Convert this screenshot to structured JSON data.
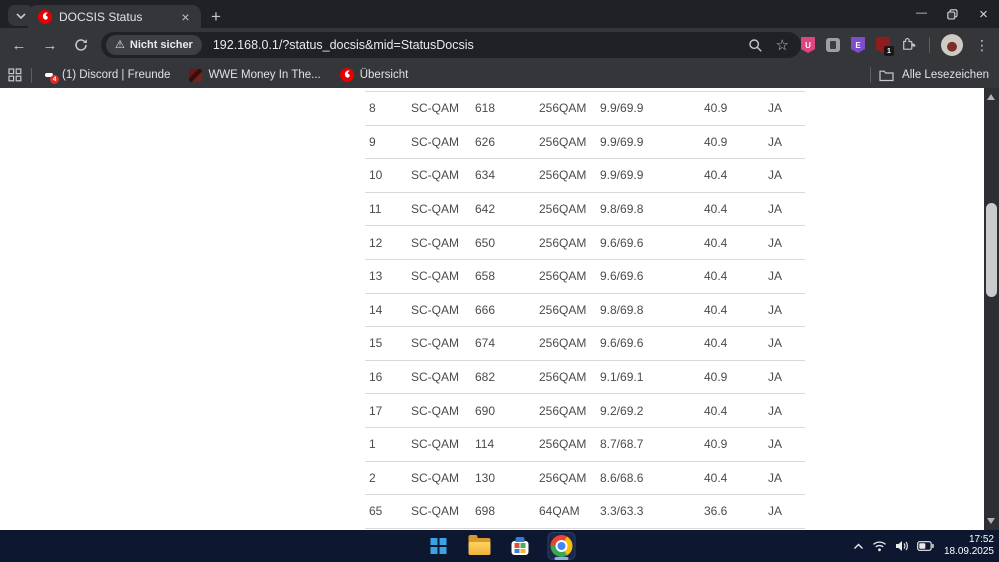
{
  "browser": {
    "tab": {
      "title": "DOCSIS Status",
      "close_glyph": "×"
    },
    "new_tab_glyph": "+",
    "window_controls": {
      "minimize_glyph": "—",
      "close_glyph": "×"
    },
    "nav": {
      "back_glyph": "←",
      "forward_glyph": "→"
    },
    "omnibox": {
      "warning_glyph": "⚠",
      "security_label": "Nicht sicher",
      "url": "192.168.0.1/?status_docsis&mid=StatusDocsis",
      "star_glyph": "☆"
    },
    "extensions": {
      "ext1_letter": "U",
      "ext3_letter": "E",
      "ext4_badge": "1"
    },
    "menu_glyph": "⋮",
    "bookmarks": {
      "items": [
        {
          "label": "(1) Discord | Freunde",
          "badge": "4"
        },
        {
          "label": "WWE Money In The..."
        },
        {
          "label": "Übersicht"
        }
      ],
      "all_label": "Alle Lesezeichen"
    }
  },
  "page": {
    "table_rows": [
      [
        "8",
        "SC-QAM",
        "618",
        "256QAM",
        "9.9/69.9",
        "40.9",
        "JA"
      ],
      [
        "9",
        "SC-QAM",
        "626",
        "256QAM",
        "9.9/69.9",
        "40.9",
        "JA"
      ],
      [
        "10",
        "SC-QAM",
        "634",
        "256QAM",
        "9.9/69.9",
        "40.4",
        "JA"
      ],
      [
        "11",
        "SC-QAM",
        "642",
        "256QAM",
        "9.8/69.8",
        "40.4",
        "JA"
      ],
      [
        "12",
        "SC-QAM",
        "650",
        "256QAM",
        "9.6/69.6",
        "40.4",
        "JA"
      ],
      [
        "13",
        "SC-QAM",
        "658",
        "256QAM",
        "9.6/69.6",
        "40.4",
        "JA"
      ],
      [
        "14",
        "SC-QAM",
        "666",
        "256QAM",
        "9.8/69.8",
        "40.4",
        "JA"
      ],
      [
        "15",
        "SC-QAM",
        "674",
        "256QAM",
        "9.6/69.6",
        "40.4",
        "JA"
      ],
      [
        "16",
        "SC-QAM",
        "682",
        "256QAM",
        "9.1/69.1",
        "40.9",
        "JA"
      ],
      [
        "17",
        "SC-QAM",
        "690",
        "256QAM",
        "9.2/69.2",
        "40.4",
        "JA"
      ],
      [
        "1",
        "SC-QAM",
        "114",
        "256QAM",
        "8.7/68.7",
        "40.9",
        "JA"
      ],
      [
        "2",
        "SC-QAM",
        "130",
        "256QAM",
        "8.6/68.6",
        "40.4",
        "JA"
      ],
      [
        "65",
        "SC-QAM",
        "698",
        "64QAM",
        "3.3/63.3",
        "36.6",
        "JA"
      ]
    ]
  },
  "taskbar": {
    "clock": {
      "time": "17:52",
      "date": "18.09.2025"
    }
  },
  "colors": {
    "vodafone_red": "#e60000",
    "discord_blue": "#5865f2",
    "taskbar_bg": "#0d1830",
    "toolbar_bg": "#35363a",
    "tabstrip_bg": "#202124",
    "table_text": "#4b4b4b",
    "table_divider": "#d9d9d9"
  }
}
